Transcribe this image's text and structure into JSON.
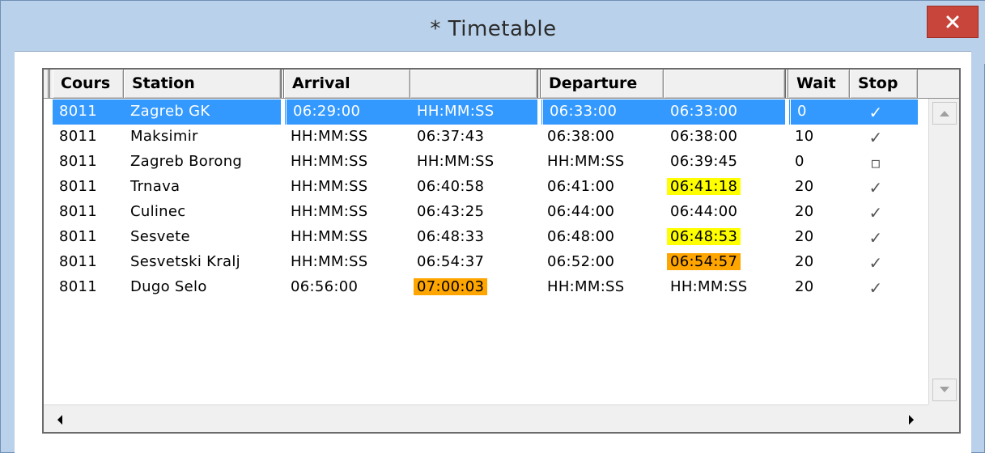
{
  "window": {
    "title": "* Timetable",
    "close_icon": "close-icon"
  },
  "table": {
    "columns": [
      "Cours",
      "Station",
      "Arrival",
      "",
      "Departure",
      "",
      "Wait",
      "Stop"
    ],
    "rows": [
      {
        "cours": "8011",
        "station": "Zagreb GK",
        "arr_planned": "06:29:00",
        "arr_actual": "HH:MM:SS",
        "dep_planned": "06:33:00",
        "dep_actual": "06:33:00",
        "wait": "0",
        "stop": "✓",
        "selected": true
      },
      {
        "cours": "8011",
        "station": "Maksimir",
        "arr_planned": "HH:MM:SS",
        "arr_actual": "06:37:43",
        "dep_planned": "06:38:00",
        "dep_actual": "06:38:00",
        "wait": "10",
        "stop": "✓"
      },
      {
        "cours": "8011",
        "station": "Zagreb Borong",
        "arr_planned": "HH:MM:SS",
        "arr_actual": "HH:MM:SS",
        "dep_planned": "HH:MM:SS",
        "dep_actual": "06:39:45",
        "wait": "0",
        "stop": "▫"
      },
      {
        "cours": "8011",
        "station": "Trnava",
        "arr_planned": "HH:MM:SS",
        "arr_actual": "06:40:58",
        "dep_planned": "06:41:00",
        "dep_actual": "06:41:18",
        "wait": "20",
        "stop": "✓",
        "hl_dep_actual": "yellow"
      },
      {
        "cours": "8011",
        "station": "Culinec",
        "arr_planned": "HH:MM:SS",
        "arr_actual": "06:43:25",
        "dep_planned": "06:44:00",
        "dep_actual": "06:44:00",
        "wait": "20",
        "stop": "✓"
      },
      {
        "cours": "8011",
        "station": "Sesvete",
        "arr_planned": "HH:MM:SS",
        "arr_actual": "06:48:33",
        "dep_planned": "06:48:00",
        "dep_actual": "06:48:53",
        "wait": "20",
        "stop": "✓",
        "hl_dep_actual": "yellow"
      },
      {
        "cours": "8011",
        "station": "Sesvetski Kralj",
        "arr_planned": "HH:MM:SS",
        "arr_actual": "06:54:37",
        "dep_planned": "06:52:00",
        "dep_actual": "06:54:57",
        "wait": "20",
        "stop": "✓",
        "hl_dep_actual": "orange"
      },
      {
        "cours": "8011",
        "station": "Dugo Selo",
        "arr_planned": "06:56:00",
        "arr_actual": "07:00:03",
        "dep_planned": "HH:MM:SS",
        "dep_actual": "HH:MM:SS",
        "wait": "20",
        "stop": "✓",
        "hl_arr_actual": "orange"
      }
    ]
  },
  "colors": {
    "selection": "#3399ff",
    "highlight_yellow": "#ffff00",
    "highlight_orange": "#ffa500",
    "title_bar": "#b9d1ea",
    "close_button": "#c7453a"
  },
  "icons": {
    "scroll_up": "arrow-up-icon",
    "scroll_down": "arrow-down-icon",
    "scroll_left": "arrow-left-icon",
    "scroll_right": "arrow-right-icon"
  }
}
